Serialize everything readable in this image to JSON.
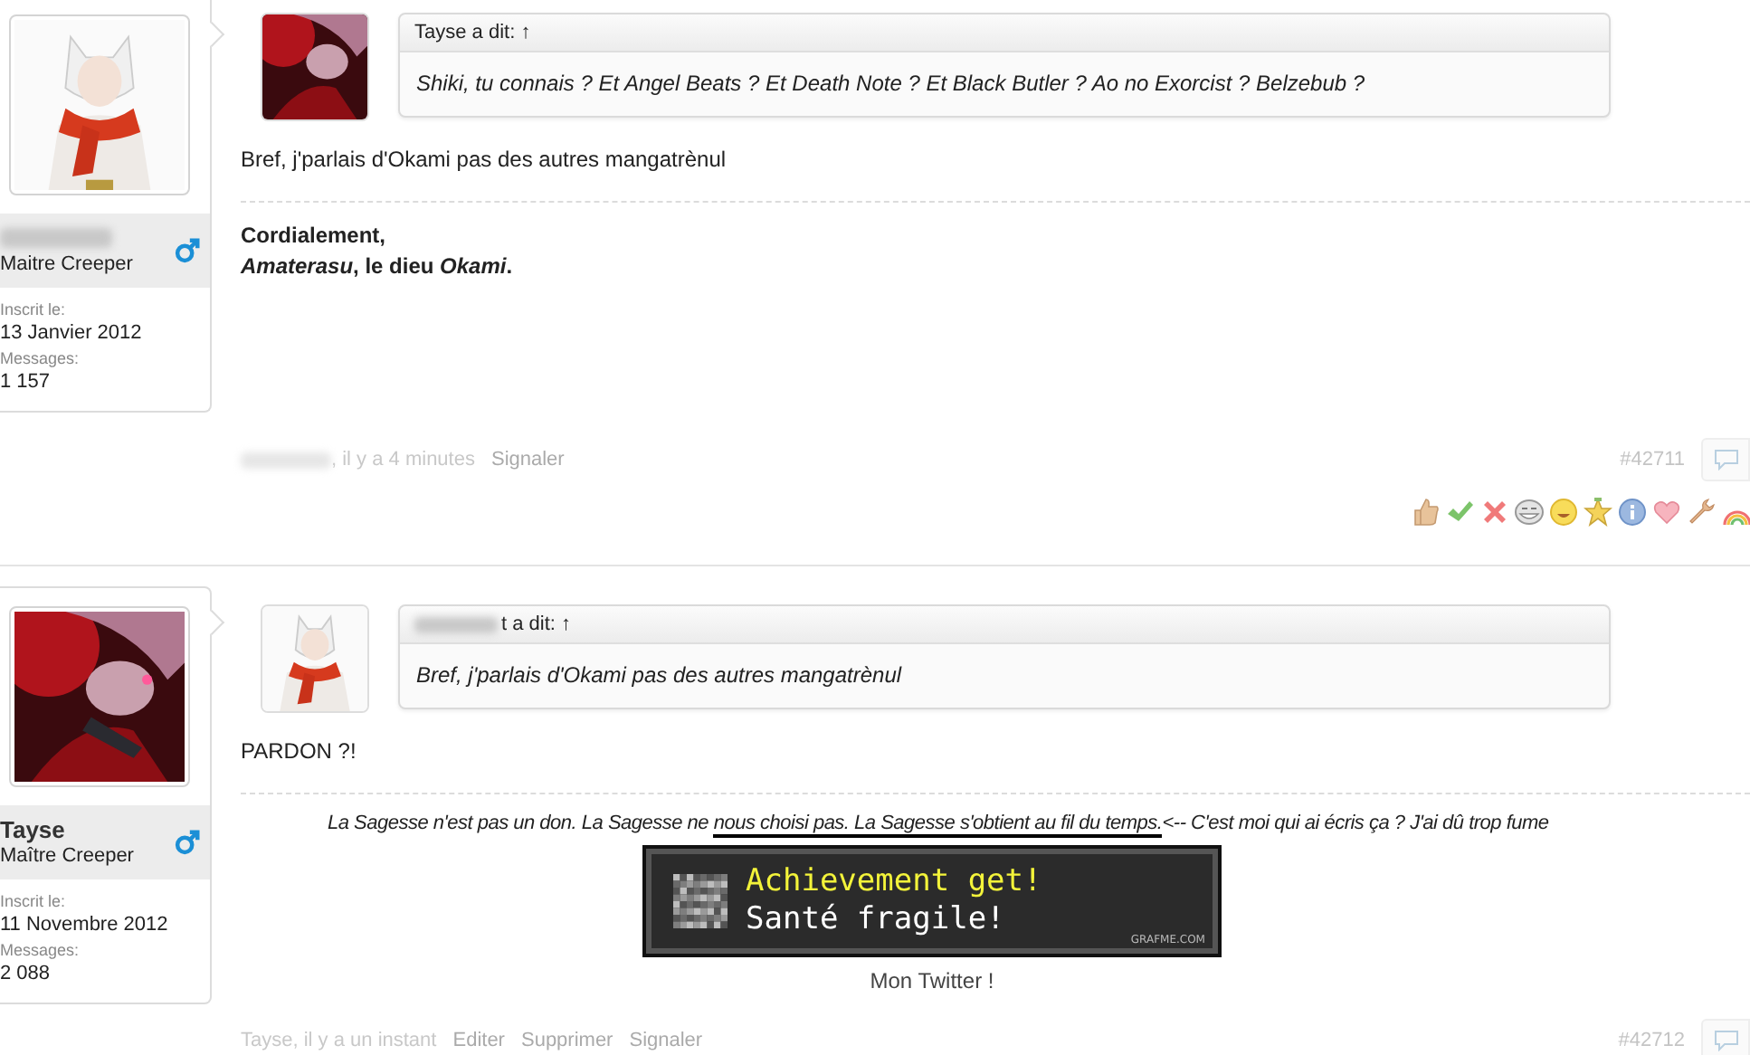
{
  "posts": [
    {
      "author": {
        "name_blurred": true,
        "rank": "Maitre Creeper",
        "joined_label": "Inscrit le:",
        "joined": "13 Janvier 2012",
        "messages_label": "Messages:",
        "messages": "1 157"
      },
      "quote": {
        "author_blurred": false,
        "header": "Tayse a dit: ↑",
        "text": "Shiki, tu connais ? Et Angel Beats ? Et Death Note ? Et Black Butler ? Ao no Exorcist ? Belzebub ?"
      },
      "body": "Bref, j'parlais d'Okami pas des autres mangatrènul",
      "signature": [
        {
          "kind": "bold-line",
          "text": "Cordialement,"
        },
        {
          "kind": "bold-line",
          "text": "*Amaterasu*, le dieu *Okami*."
        }
      ],
      "byline_blurred": true,
      "byline": ", il y a 4 minutes",
      "actions": [
        "Signaler"
      ],
      "number": "#42711",
      "reactions_visible": true
    },
    {
      "author": {
        "name": "Tayse",
        "name_blurred": false,
        "rank": "Maître Creeper",
        "joined_label": "Inscrit le:",
        "joined": "11 Novembre 2012",
        "messages_label": "Messages:",
        "messages": "2 088"
      },
      "quote": {
        "author_blurred": true,
        "header": "t a dit: ↑",
        "text": "Bref, j'parlais d'Okami pas des autres mangatrènul"
      },
      "body": "PARDON ?!",
      "signature": [
        {
          "kind": "segments",
          "segments": [
            {
              "text": "La Sagesse n'est pas un don. La Sagesse ne ",
              "underlined": false
            },
            {
              "text": "nous choisi pas. La Sagesse s'obtient au fil du temps.",
              "underlined": true
            },
            {
              "text": "<-- C'est moi qui ai écris ça ? J'ai dû trop fume",
              "underlined": false
            }
          ]
        },
        {
          "kind": "achievement",
          "title": "Achievement get!",
          "subtitle": "Santé fragile!",
          "credit": "GRAFME.COM"
        },
        {
          "kind": "caption",
          "text": "Mon Twitter !"
        }
      ],
      "byline_blurred": false,
      "byline": "Tayse, il y a un instant",
      "actions": [
        "Editer",
        "Supprimer",
        "Signaler"
      ],
      "number": "#42712",
      "reactions_visible": false
    }
  ]
}
